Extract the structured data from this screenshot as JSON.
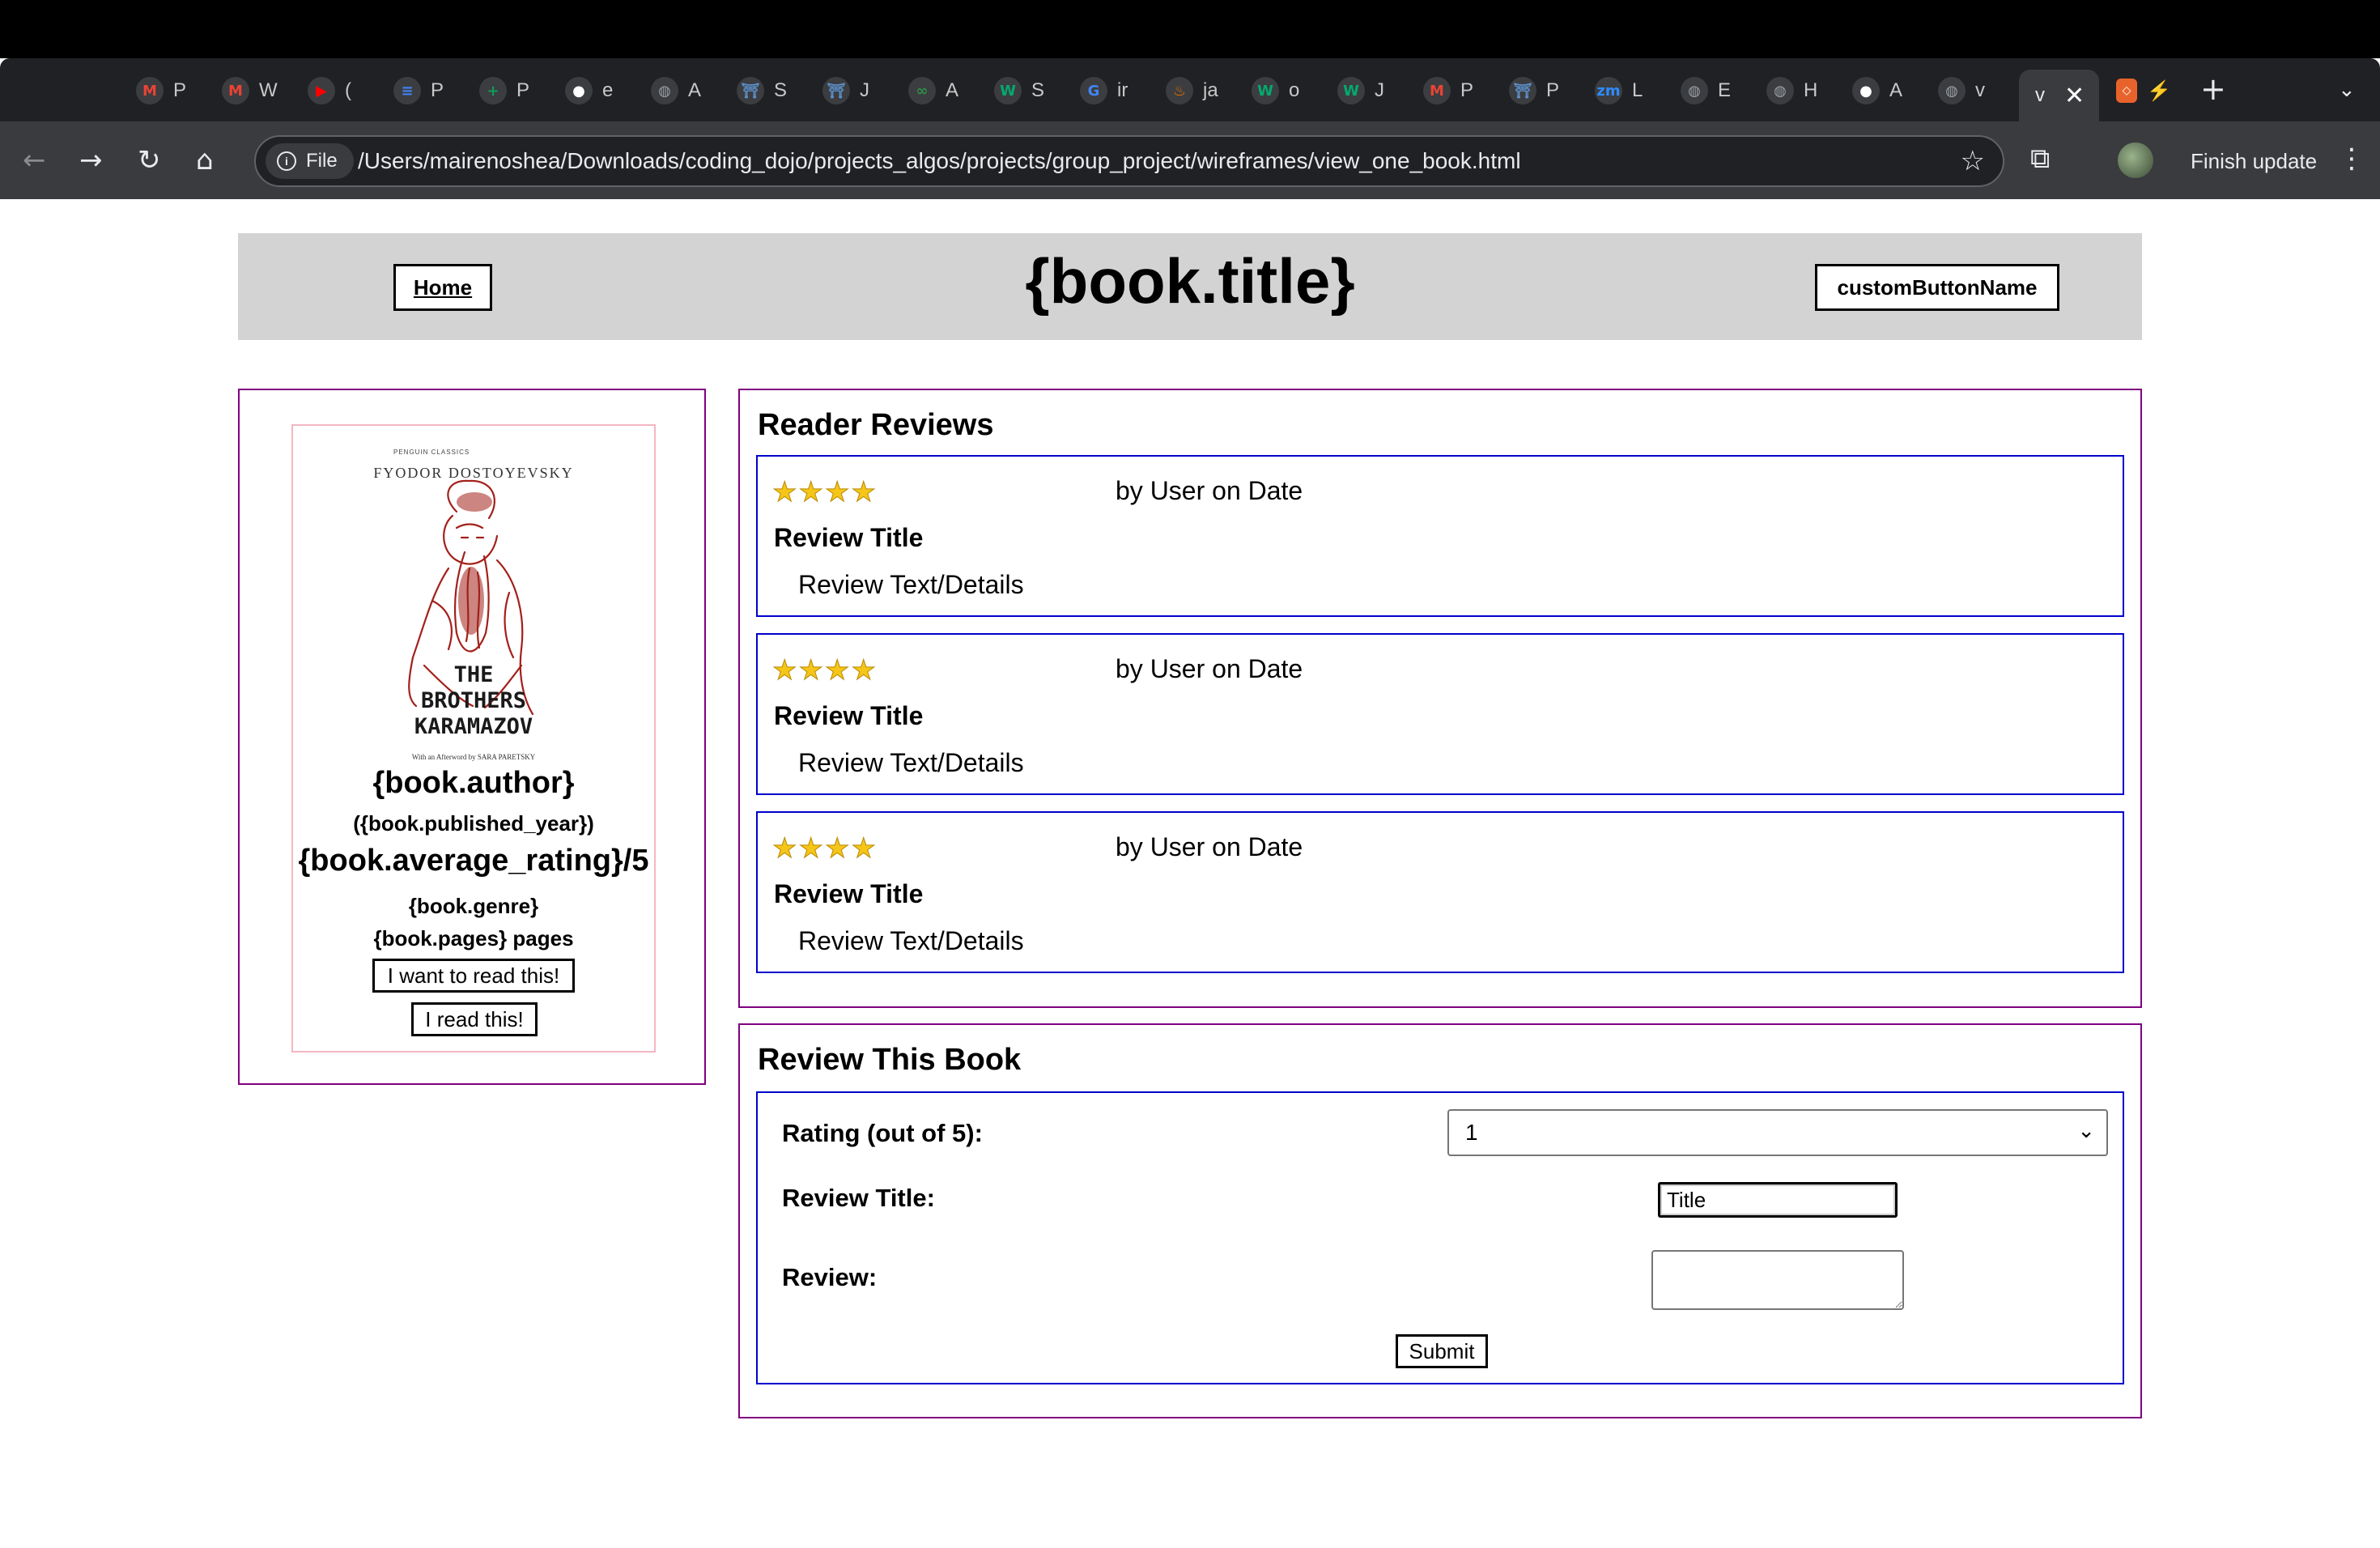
{
  "browser": {
    "tabs": [
      {
        "icon": "gmail-icon",
        "label": "P",
        "color": "#ea4335",
        "glyph": "M"
      },
      {
        "icon": "gmail-icon",
        "label": "W",
        "color": "#ea4335",
        "glyph": "M"
      },
      {
        "icon": "youtube-icon",
        "label": "(",
        "color": "#ff0000",
        "glyph": "▶"
      },
      {
        "icon": "google-docs-icon",
        "label": "P",
        "color": "#4285f4",
        "glyph": "≡"
      },
      {
        "icon": "google-sheets-icon",
        "label": "P",
        "color": "#0f9d58",
        "glyph": "+"
      },
      {
        "icon": "github-icon",
        "label": "e",
        "color": "#ffffff",
        "glyph": "●"
      },
      {
        "icon": "globe-icon",
        "label": "A",
        "color": "#9aa0a6",
        "glyph": "◍"
      },
      {
        "icon": "coding-dojo-icon",
        "label": "S",
        "color": "#5b8fc7",
        "glyph": "⛩"
      },
      {
        "icon": "coding-dojo-icon",
        "label": "J",
        "color": "#5b8fc7",
        "glyph": "⛩"
      },
      {
        "icon": "geeksforgeeks-icon",
        "label": "A",
        "color": "#2f8d46",
        "glyph": "∞"
      },
      {
        "icon": "w3schools-icon",
        "label": "S",
        "color": "#04aa6d",
        "glyph": "W"
      },
      {
        "icon": "google-icon",
        "label": "ir",
        "color": "#4285f4",
        "glyph": "G"
      },
      {
        "icon": "java-icon",
        "label": "ja",
        "color": "#e76f00",
        "glyph": "♨"
      },
      {
        "icon": "w3schools-icon",
        "label": "o",
        "color": "#04aa6d",
        "glyph": "W"
      },
      {
        "icon": "w3schools-icon",
        "label": "J",
        "color": "#04aa6d",
        "glyph": "W"
      },
      {
        "icon": "gmail-icon",
        "label": "P",
        "color": "#ea4335",
        "glyph": "M"
      },
      {
        "icon": "coding-dojo-icon",
        "label": "P",
        "color": "#5b8fc7",
        "glyph": "⛩"
      },
      {
        "icon": "zoom-icon",
        "label": "L",
        "color": "#2d8cff",
        "glyph": "zm"
      },
      {
        "icon": "globe-icon",
        "label": "E",
        "color": "#9aa0a6",
        "glyph": "◍"
      },
      {
        "icon": "globe-icon",
        "label": "H",
        "color": "#9aa0a6",
        "glyph": "◍"
      },
      {
        "icon": "github-icon",
        "label": "A",
        "color": "#ffffff",
        "glyph": "●"
      },
      {
        "icon": "globe-icon",
        "label": "v",
        "color": "#9aa0a6",
        "glyph": "◍"
      }
    ],
    "active_tab": {
      "label": "v"
    },
    "extra_tab": {
      "icon": "html-file-icon",
      "label": "⚡"
    },
    "new_tab_label": "+",
    "address": {
      "scheme_label": "File",
      "url": "/Users/mairenoshea/Downloads/coding_dojo/projects_algos/projects/group_project/wireframes/view_one_book.html"
    },
    "finish_update": "Finish update"
  },
  "header": {
    "home": "Home",
    "title": "{book.title}",
    "custom_button": "customButtonName"
  },
  "book": {
    "cover": {
      "publisher": "PENGUIN CLASSICS",
      "author": "FYODOR DOSTOYEVSKY",
      "title_line1": "THE",
      "title_line2": "BROTHERS",
      "title_line3": "KARAMAZOV",
      "afterword": "With an Afterword by SARA PARETSKY"
    },
    "author": "{book.author}",
    "published_year": "({book.published_year})",
    "average_rating": "{book.average_rating}/5",
    "genre": "{book.genre}",
    "pages": "{book.pages} pages",
    "want_to_read": "I want to read this!",
    "read_this": "I read this!"
  },
  "reviews": {
    "heading": "Reader Reviews",
    "items": [
      {
        "stars": "★★★★",
        "byline": "by User on Date",
        "title": "Review Title",
        "text": "Review Text/Details"
      },
      {
        "stars": "★★★★",
        "byline": "by User on Date",
        "title": "Review Title",
        "text": "Review Text/Details"
      },
      {
        "stars": "★★★★",
        "byline": "by User on Date",
        "title": "Review Title",
        "text": "Review Text/Details"
      }
    ]
  },
  "form": {
    "heading": "Review This Book",
    "rating_label": "Rating (out of 5):",
    "rating_value": "1",
    "title_label": "Review Title:",
    "title_value": "Title",
    "review_label": "Review:",
    "submit": "Submit"
  }
}
